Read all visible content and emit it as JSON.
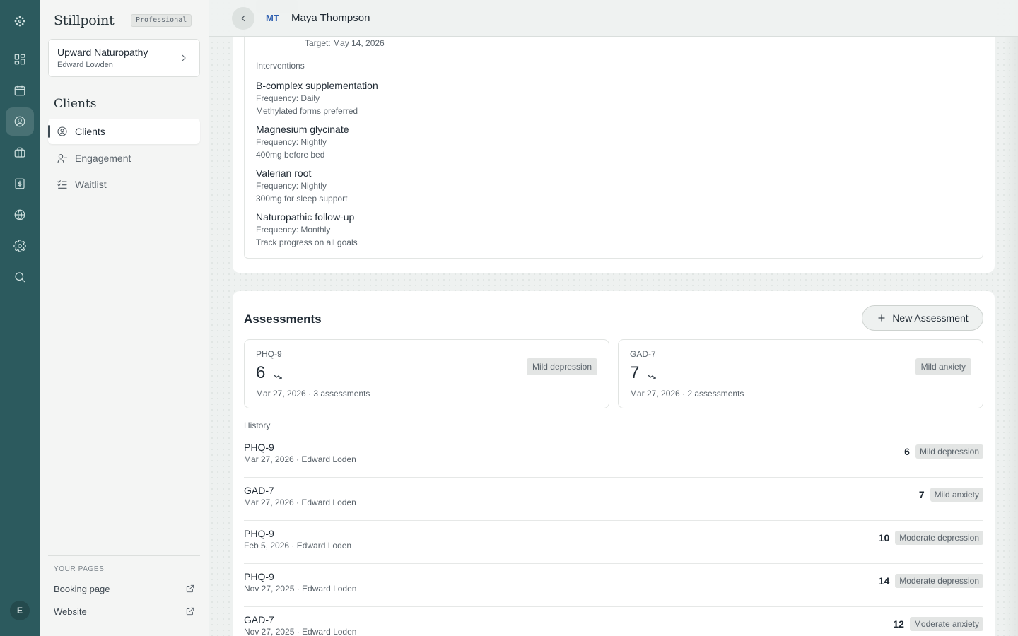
{
  "rail": {
    "items": [
      {
        "icon": "logo-icon"
      },
      {
        "icon": "dashboard-icon"
      },
      {
        "icon": "calendar-icon"
      },
      {
        "icon": "clients-icon",
        "active": true
      },
      {
        "icon": "briefcase-icon"
      },
      {
        "icon": "billing-icon"
      },
      {
        "icon": "globe-icon"
      },
      {
        "icon": "settings-icon"
      },
      {
        "icon": "search-icon"
      }
    ],
    "avatar_initial": "E"
  },
  "sidebar": {
    "brand": "Stillpoint",
    "plan": "Professional",
    "org": {
      "name": "Upward Naturopathy",
      "owner": "Edward Lowden"
    },
    "section_title": "Clients",
    "nav": [
      {
        "label": "Clients",
        "icon": "user-circle-icon",
        "active": true
      },
      {
        "label": "Engagement",
        "icon": "user-minus-icon",
        "active": false
      },
      {
        "label": "Waitlist",
        "icon": "list-checks-icon",
        "active": false
      }
    ],
    "pages_label": "YOUR PAGES",
    "pages": [
      {
        "label": "Booking page",
        "icon": "external-link-icon"
      },
      {
        "label": "Website",
        "icon": "external-link-icon"
      }
    ]
  },
  "header": {
    "client_initials": "MT",
    "client_name": "Maya Thompson"
  },
  "plan": {
    "goal_target": "Target: May 14, 2026",
    "interventions_label": "Interventions",
    "interventions": [
      {
        "name": "B-complex supplementation",
        "frequency": "Frequency: Daily",
        "note": "Methylated forms preferred"
      },
      {
        "name": "Magnesium glycinate",
        "frequency": "Frequency: Nightly",
        "note": "400mg before bed"
      },
      {
        "name": "Valerian root",
        "frequency": "Frequency: Nightly",
        "note": "300mg for sleep support"
      },
      {
        "name": "Naturopathic follow-up",
        "frequency": "Frequency: Monthly",
        "note": "Track progress on all goals"
      }
    ]
  },
  "assessments": {
    "title": "Assessments",
    "new_button": "New Assessment",
    "summaries": [
      {
        "name": "PHQ-9",
        "score": "6",
        "trend": "down",
        "badge": "Mild depression",
        "meta": "Mar 27, 2026 · 3 assessments"
      },
      {
        "name": "GAD-7",
        "score": "7",
        "trend": "down",
        "badge": "Mild anxiety",
        "meta": "Mar 27, 2026 · 2 assessments"
      }
    ],
    "history_label": "History",
    "history": [
      {
        "name": "PHQ-9",
        "meta": "Mar 27, 2026 · Edward Loden",
        "score": "6",
        "badge": "Mild depression"
      },
      {
        "name": "GAD-7",
        "meta": "Mar 27, 2026 · Edward Loden",
        "score": "7",
        "badge": "Mild anxiety"
      },
      {
        "name": "PHQ-9",
        "meta": "Feb 5, 2026 · Edward Loden",
        "score": "10",
        "badge": "Moderate depression"
      },
      {
        "name": "PHQ-9",
        "meta": "Nov 27, 2025 · Edward Loden",
        "score": "14",
        "badge": "Moderate depression"
      },
      {
        "name": "GAD-7",
        "meta": "Nov 27, 2025 · Edward Loden",
        "score": "12",
        "badge": "Moderate anxiety"
      }
    ]
  },
  "colors": {
    "rail_bg": "#2c5a5e",
    "accent_initials": "#2e5fb0",
    "badge_bg": "#e3e5e4"
  }
}
